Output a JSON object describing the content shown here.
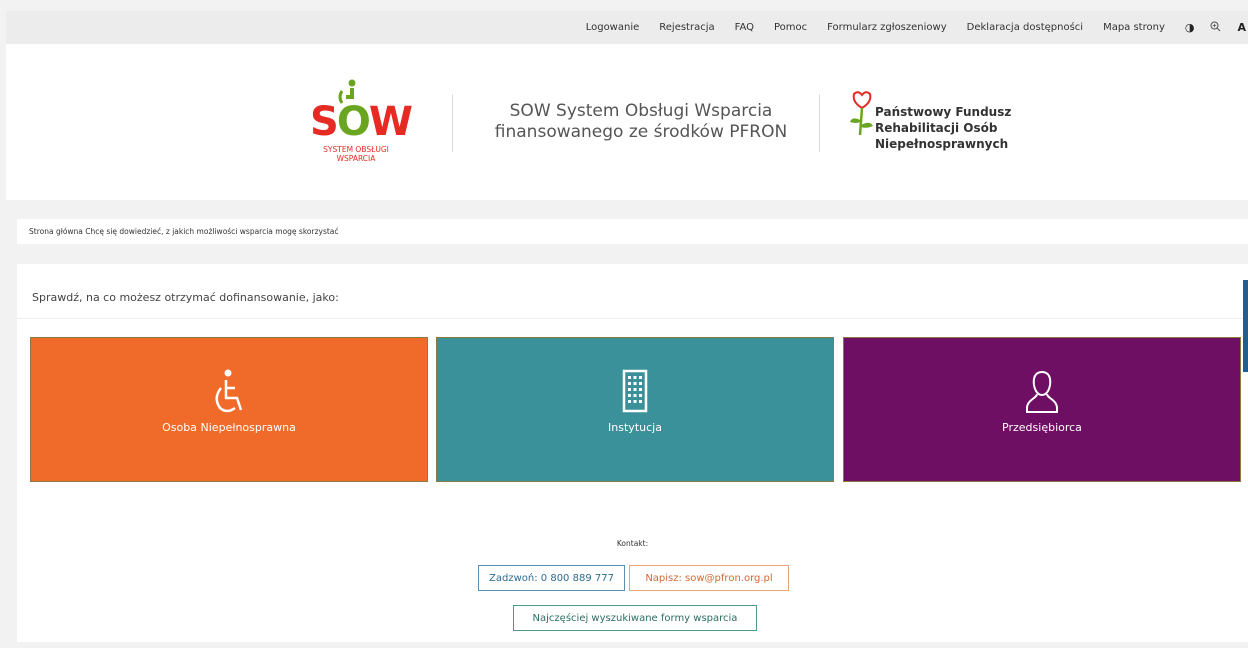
{
  "topnav": {
    "items": [
      "Logowanie",
      "Rejestracja",
      "FAQ",
      "Pomoc",
      "Formularz zgłoszeniowy",
      "Deklaracja dostępności",
      "Mapa strony"
    ],
    "tools": [
      "contrast-icon",
      "zoom-icon",
      "font-icon"
    ]
  },
  "header": {
    "logo_word": {
      "s": "S",
      "o": "O",
      "w": "W"
    },
    "logo_sub_1": "SYSTEM OBSŁUGI",
    "logo_sub_2": "WSPARCIA",
    "title_line1": "SOW System Obsługi Wsparcia",
    "title_line2": "finansowanego ze środków PFRON",
    "pfron_line1": "Państwowy Fundusz",
    "pfron_line2": "Rehabilitacji Osób",
    "pfron_line3": "Niepełnosprawnych"
  },
  "breadcrumb": {
    "home": "Strona główna",
    "current": "Chcę się dowiedzieć, z jakich możliwości wsparcia mogę skorzystać"
  },
  "main": {
    "section_title": "Sprawdź, na co możesz otrzymać dofinansowanie, jako:",
    "tiles": [
      {
        "label": "Osoba Niepełnosprawna",
        "icon": "wheelchair-icon",
        "color": "#f06a2a"
      },
      {
        "label": "Instytucja",
        "icon": "building-icon",
        "color": "#3b9199"
      },
      {
        "label": "Przedsiębiorca",
        "icon": "person-icon",
        "color": "#6e0f63"
      }
    ],
    "contact_label": "Kontakt:",
    "call_button": "Zadzwoń: 0 800 889 777",
    "write_button": "Napisz: sow@pfron.org.pl",
    "faq_button": "Najczęściej wyszukiwane formy wsparcia"
  }
}
